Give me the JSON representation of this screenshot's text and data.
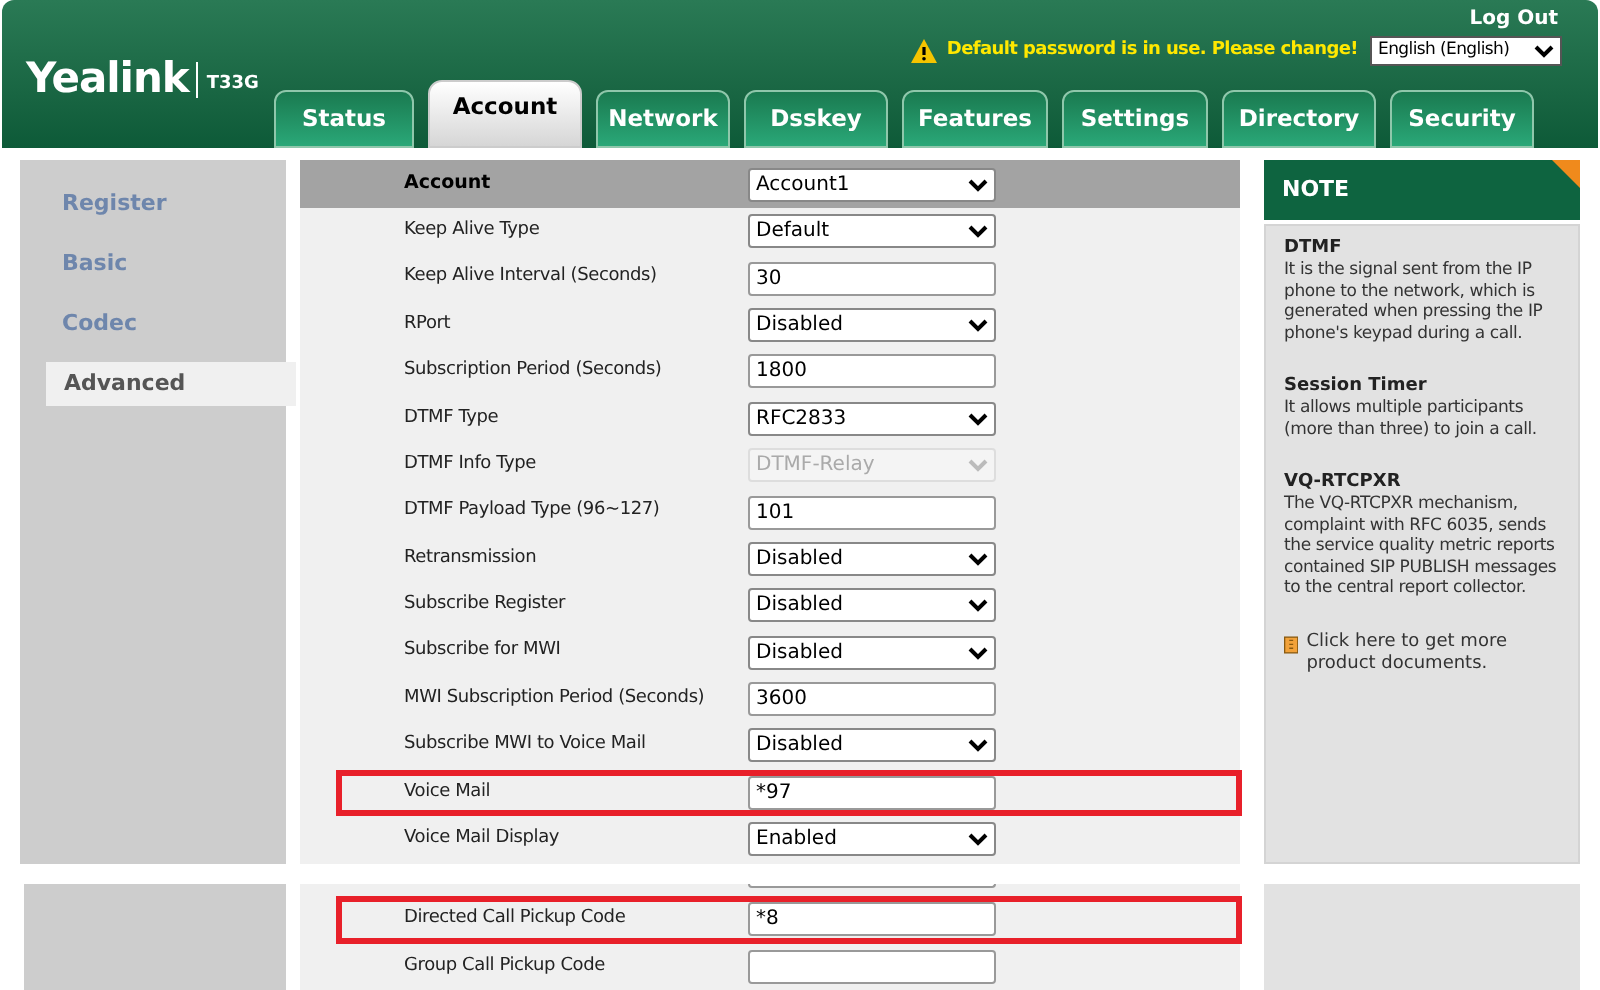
{
  "header": {
    "logo": "Yealink",
    "model": "T33G",
    "logout": "Log Out",
    "warning": "Default password is in use. Please change!",
    "language": "English (English)"
  },
  "tabs": [
    {
      "label": "Status",
      "selected": false
    },
    {
      "label": "Account",
      "selected": true
    },
    {
      "label": "Network",
      "selected": false
    },
    {
      "label": "Dsskey",
      "selected": false
    },
    {
      "label": "Features",
      "selected": false
    },
    {
      "label": "Settings",
      "selected": false
    },
    {
      "label": "Directory",
      "selected": false
    },
    {
      "label": "Security",
      "selected": false
    }
  ],
  "sidebar": {
    "items": [
      {
        "label": "Register",
        "selected": false
      },
      {
        "label": "Basic",
        "selected": false
      },
      {
        "label": "Codec",
        "selected": false
      },
      {
        "label": "Advanced",
        "selected": true
      }
    ]
  },
  "form": {
    "header": {
      "label": "Account",
      "value": "Account1"
    },
    "rows": [
      {
        "label": "Keep Alive Type",
        "kind": "select",
        "value": "Default",
        "disabled": false,
        "highlighted": false
      },
      {
        "label": "Keep Alive Interval (Seconds)",
        "kind": "input",
        "value": "30",
        "disabled": false,
        "highlighted": false
      },
      {
        "label": "RPort",
        "kind": "select",
        "value": "Disabled",
        "disabled": false,
        "highlighted": false
      },
      {
        "label": "Subscription Period (Seconds)",
        "kind": "input",
        "value": "1800",
        "disabled": false,
        "highlighted": false
      },
      {
        "label": "DTMF Type",
        "kind": "select",
        "value": "RFC2833",
        "disabled": false,
        "highlighted": false
      },
      {
        "label": "DTMF Info Type",
        "kind": "select",
        "value": "DTMF-Relay",
        "disabled": true,
        "highlighted": false
      },
      {
        "label": "DTMF Payload Type (96~127)",
        "kind": "input",
        "value": "101",
        "disabled": false,
        "highlighted": false
      },
      {
        "label": "Retransmission",
        "kind": "select",
        "value": "Disabled",
        "disabled": false,
        "highlighted": false
      },
      {
        "label": "Subscribe Register",
        "kind": "select",
        "value": "Disabled",
        "disabled": false,
        "highlighted": false
      },
      {
        "label": "Subscribe for MWI",
        "kind": "select",
        "value": "Disabled",
        "disabled": false,
        "highlighted": false
      },
      {
        "label": "MWI Subscription Period (Seconds)",
        "kind": "input",
        "value": "3600",
        "disabled": false,
        "highlighted": false
      },
      {
        "label": "Subscribe MWI to Voice Mail",
        "kind": "select",
        "value": "Disabled",
        "disabled": false,
        "highlighted": false
      },
      {
        "label": "Voice Mail",
        "kind": "input",
        "value": "*97",
        "disabled": false,
        "highlighted": true
      },
      {
        "label": "Voice Mail Display",
        "kind": "select",
        "value": "Enabled",
        "disabled": false,
        "highlighted": false
      }
    ],
    "lower_rows": [
      {
        "label": "Directed Call Pickup Code",
        "kind": "input",
        "value": "*8",
        "disabled": false,
        "highlighted": true
      },
      {
        "label": "Group Call Pickup Code",
        "kind": "input",
        "value": "",
        "disabled": false,
        "highlighted": false
      }
    ]
  },
  "note": {
    "title": "NOTE",
    "entries": [
      {
        "title": "DTMF",
        "text": "It is the signal sent from the IP phone to the network, which is generated when pressing the IP phone's keypad during a call."
      },
      {
        "title": "Session Timer",
        "text": "It allows multiple participants (more than three) to join a call."
      },
      {
        "title": "VQ-RTCPXR",
        "text": "The VQ-RTCPXR mechanism, complaint with RFC 6035, sends the service quality metric reports contained SIP PUBLISH messages to the central report collector."
      }
    ],
    "link": "Click here to get more product documents."
  }
}
